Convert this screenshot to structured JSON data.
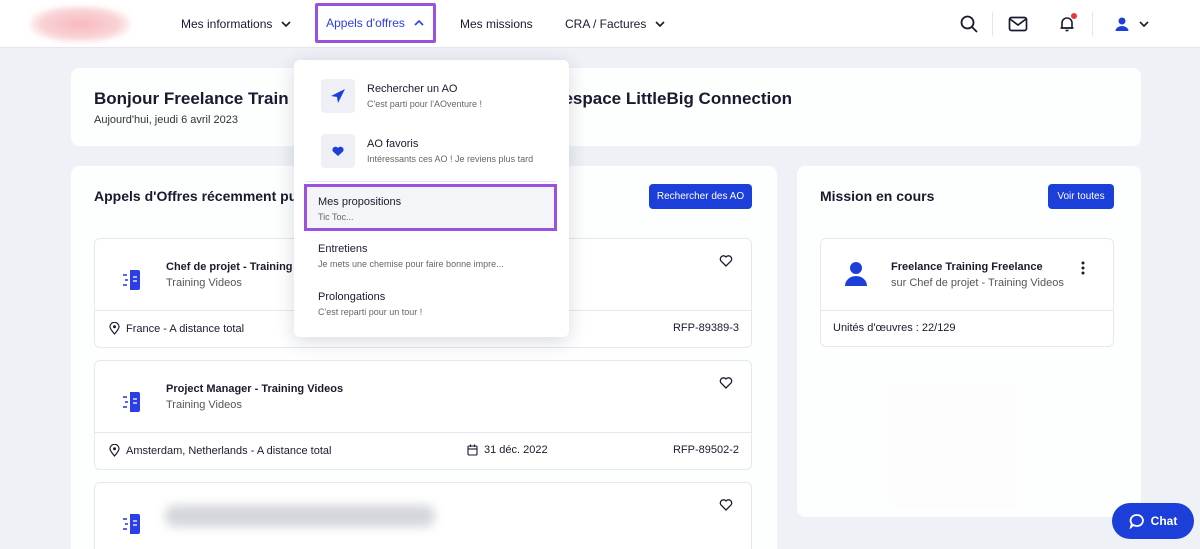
{
  "nav": {
    "items": [
      {
        "label": "Mes informations"
      },
      {
        "label": "Appels d'offres"
      },
      {
        "label": "Mes missions"
      },
      {
        "label": "CRA / Factures"
      }
    ]
  },
  "welcome": {
    "title_start": "Bonjour Freelance Train",
    "title_end": "tre espace LittleBig Connection",
    "date": "Aujourd'hui, jeudi 6 avril 2023"
  },
  "offers": {
    "title": "Appels d'Offres récemment pu",
    "search_button": "Rechercher des AO",
    "items": [
      {
        "title": "Chef de projet - Training",
        "subtitle": "Training Videos",
        "location": "France - A distance total",
        "date": "",
        "ref": "RFP-89389-3"
      },
      {
        "title": "Project Manager - Training Videos",
        "subtitle": "Training Videos",
        "location": "Amsterdam, Netherlands - A distance total",
        "date": "31 déc. 2022",
        "ref": "RFP-89502-2"
      }
    ]
  },
  "mission": {
    "title": "Mission en cours",
    "view_all_button": "Voir toutes",
    "name": "Freelance Training Freelance",
    "subtitle": "sur Chef de projet - Training Videos",
    "units": "Unités d'œuvres : 22/129"
  },
  "dropdown": {
    "items": [
      {
        "label": "Rechercher un AO",
        "desc": "C'est parti pour l'AOventure !",
        "icon": "send-icon"
      },
      {
        "label": "AO favoris",
        "desc": "Intéressants ces AO ! Je reviens plus tard",
        "icon": "heart-icon"
      },
      {
        "label": "Mes propositions",
        "desc": "Tic Toc..."
      },
      {
        "label": "Entretiens",
        "desc": "Je mets une chemise pour faire bonne impre..."
      },
      {
        "label": "Prolongations",
        "desc": "C'est reparti pour un tour !"
      }
    ]
  },
  "chat": {
    "label": "Chat"
  },
  "colors": {
    "accent": "#1b3fd8",
    "highlight": "#9b51e0",
    "notification": "#e53935"
  }
}
